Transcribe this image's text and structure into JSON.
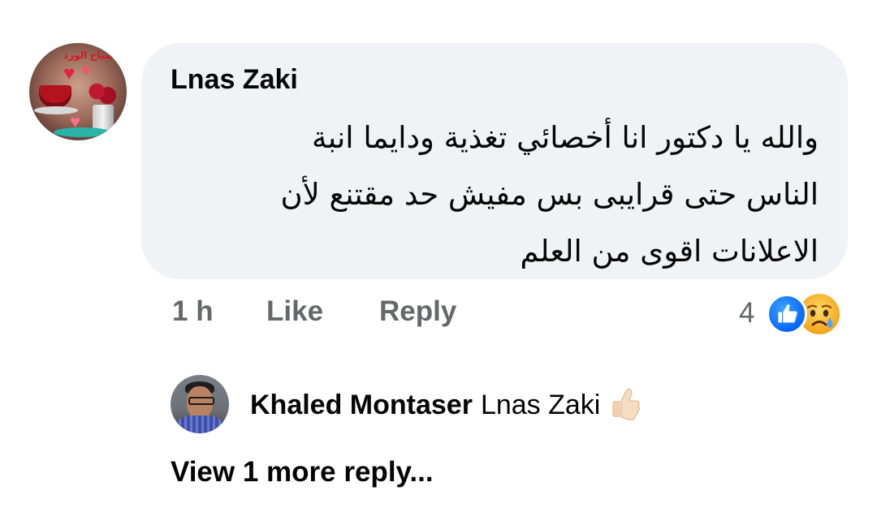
{
  "comment": {
    "author": "Lnas Zaki",
    "avatar_text": "صباح الورد",
    "text_lines": [
      "والله يا دكتور انا أخصائي تغذية ودايما انبة",
      "الناس حتى قرايبى بس مفيش حد مقتنع لأن",
      "الاعلانات اقوى من العلم"
    ],
    "time": "1 h",
    "like_label": "Like",
    "reply_label": "Reply",
    "reaction_count": "4",
    "reactions": [
      "like-icon",
      "sad-face-icon"
    ]
  },
  "reply": {
    "author": "Khaled Montaser",
    "mention": "Lnas Zaki",
    "emoji": "thumbs-up-icon"
  },
  "view_more_label": "View 1 more reply...",
  "colors": {
    "bubble_bg": "#f0f2f5",
    "meta_text": "#65676b",
    "primary_text": "#050505",
    "like_blue": "#0866ff",
    "sad_yellow": "#f7b125"
  }
}
